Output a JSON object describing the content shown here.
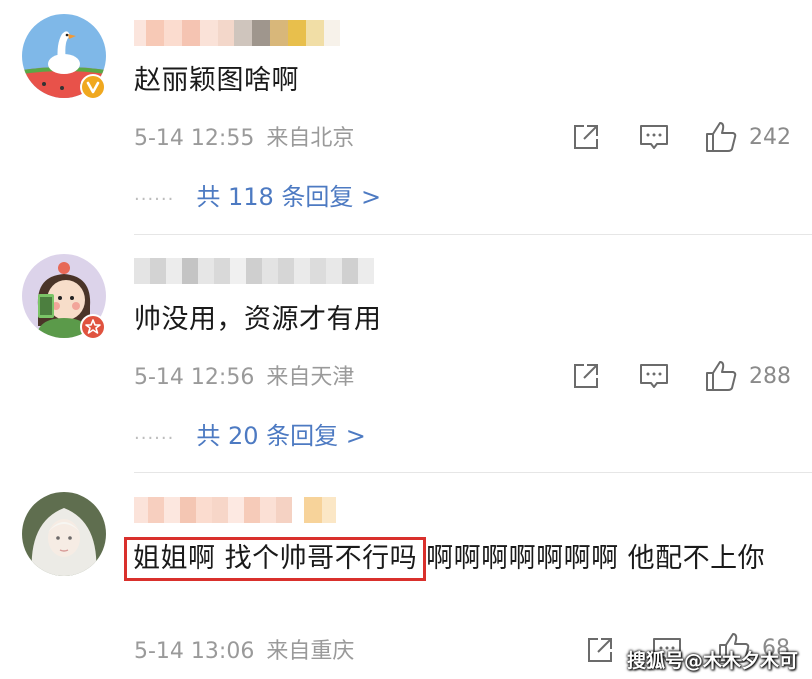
{
  "comments": [
    {
      "avatar": "goose-on-watermelon",
      "badge": "verified-v-badge",
      "content": "赵丽颖图啥啊",
      "time": "5-14 12:55",
      "location": "来自北京",
      "likes": "242",
      "replies": "共 118 条回复 >",
      "reply_dots": "......"
    },
    {
      "avatar": "cartoon-girl-with-phone",
      "badge": "star-badge",
      "content": "帅没用，资源才有用",
      "time": "5-14 12:56",
      "location": "来自天津",
      "likes": "288",
      "replies": "共 20 条回复 >",
      "reply_dots": "......"
    },
    {
      "avatar": "white-haired-anime-girl",
      "content_highlight": "姐姐啊 找个帅哥不行吗",
      "content_rest": "啊啊啊啊啊啊啊 他配不上你",
      "time": "5-14 13:06",
      "location": "来自重庆",
      "likes": "68"
    }
  ],
  "watermark": "搜狐号@木木夕木可",
  "colors": {
    "reply_link": "#4d7ac2",
    "highlight_border": "#d9302c",
    "meta_text": "#9a9a9a"
  }
}
